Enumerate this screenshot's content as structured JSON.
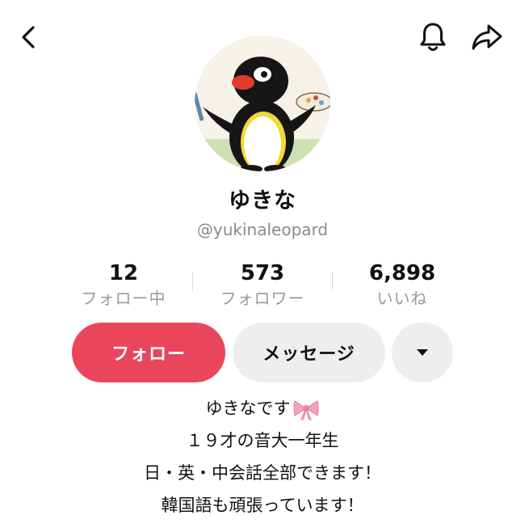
{
  "profile": {
    "display_name": "ゆきな",
    "username": "@yukinaleopard"
  },
  "stats": {
    "following": {
      "count": "12",
      "label": "フォロー中"
    },
    "followers": {
      "count": "573",
      "label": "フォロワー"
    },
    "likes": {
      "count": "6,898",
      "label": "いいね"
    }
  },
  "actions": {
    "follow_label": "フォロー",
    "message_label": "メッセージ"
  },
  "bio": {
    "line1": "ゆきなです",
    "line2": "１９才の音大一年生",
    "line3": "日・英・中会話全部できます！",
    "line4": "韓国語も頑張っています！"
  },
  "icons": {
    "back": "chevron-left-icon",
    "notifications": "bell-icon",
    "share": "share-arrow-icon",
    "more": "caret-down-icon",
    "bio_emoji": "ribbon-bow-icon"
  },
  "colors": {
    "follow_button": "#e9465c",
    "secondary_button": "#eeeeee",
    "muted_text": "#8a8a8a"
  }
}
